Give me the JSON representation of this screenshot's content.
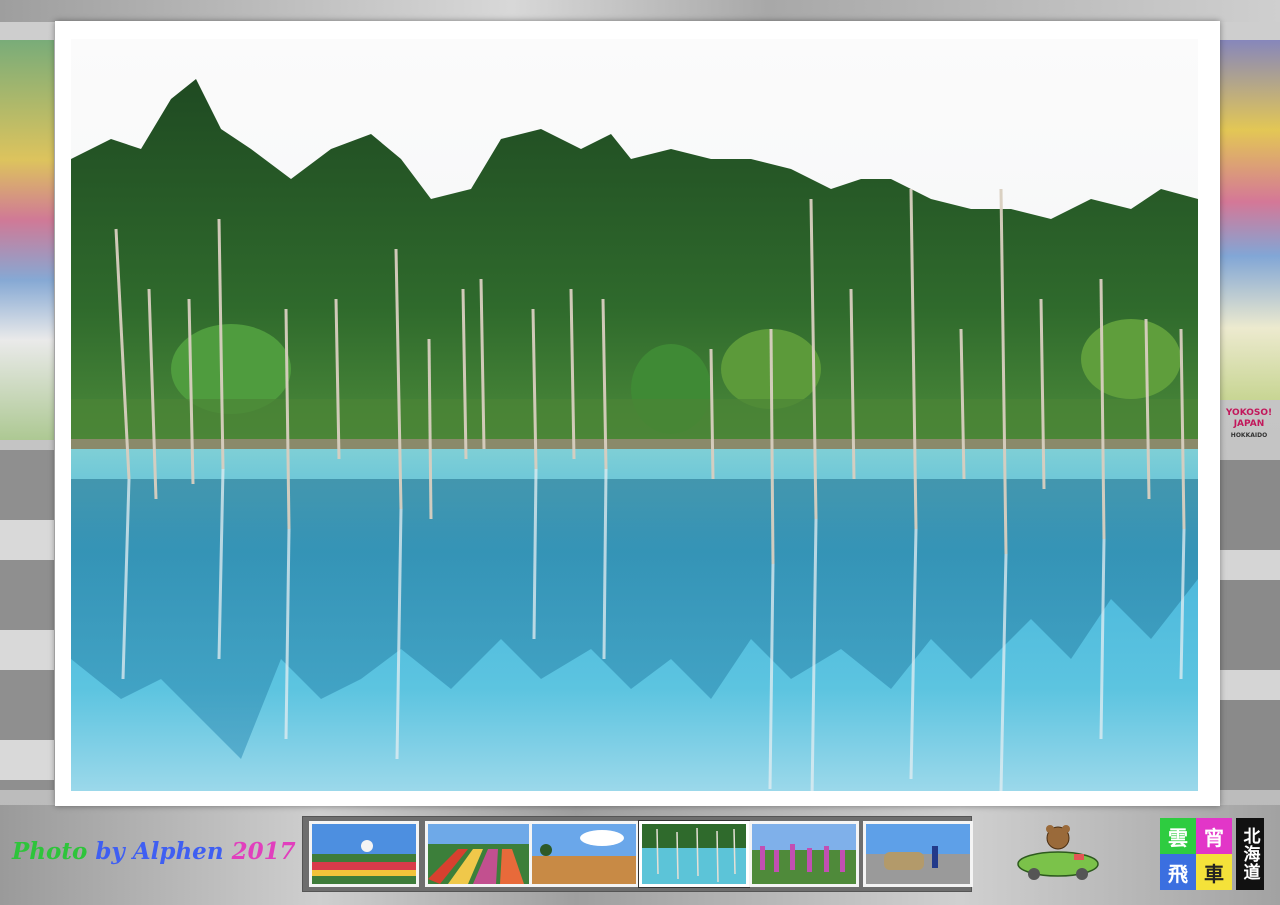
{
  "credit": {
    "prefix": "Photo",
    "middle": "by Alphen",
    "year": "2017"
  },
  "thumbnails": [
    {
      "label": "person-jumping-flower-field",
      "active": false
    },
    {
      "label": "striped-flower-fields",
      "active": false
    },
    {
      "label": "wheat-field-tree",
      "active": false
    },
    {
      "label": "blue-pond",
      "active": true
    },
    {
      "label": "lupine-flowers",
      "active": false
    },
    {
      "label": "car-on-road",
      "active": false
    }
  ],
  "logos": {
    "kanji": [
      "雲",
      "宵",
      "飛",
      "車"
    ],
    "vertical": "北海道",
    "badge_line1": "YOKOSO!",
    "badge_line2": "JAPAN",
    "badge_line3": "HOKKAIDO"
  },
  "colors": {
    "credit_green": "#2ec43b",
    "credit_blue": "#3f5ff2",
    "credit_magenta": "#e13fbd",
    "pond_turquoise": "#5cc4d8"
  }
}
